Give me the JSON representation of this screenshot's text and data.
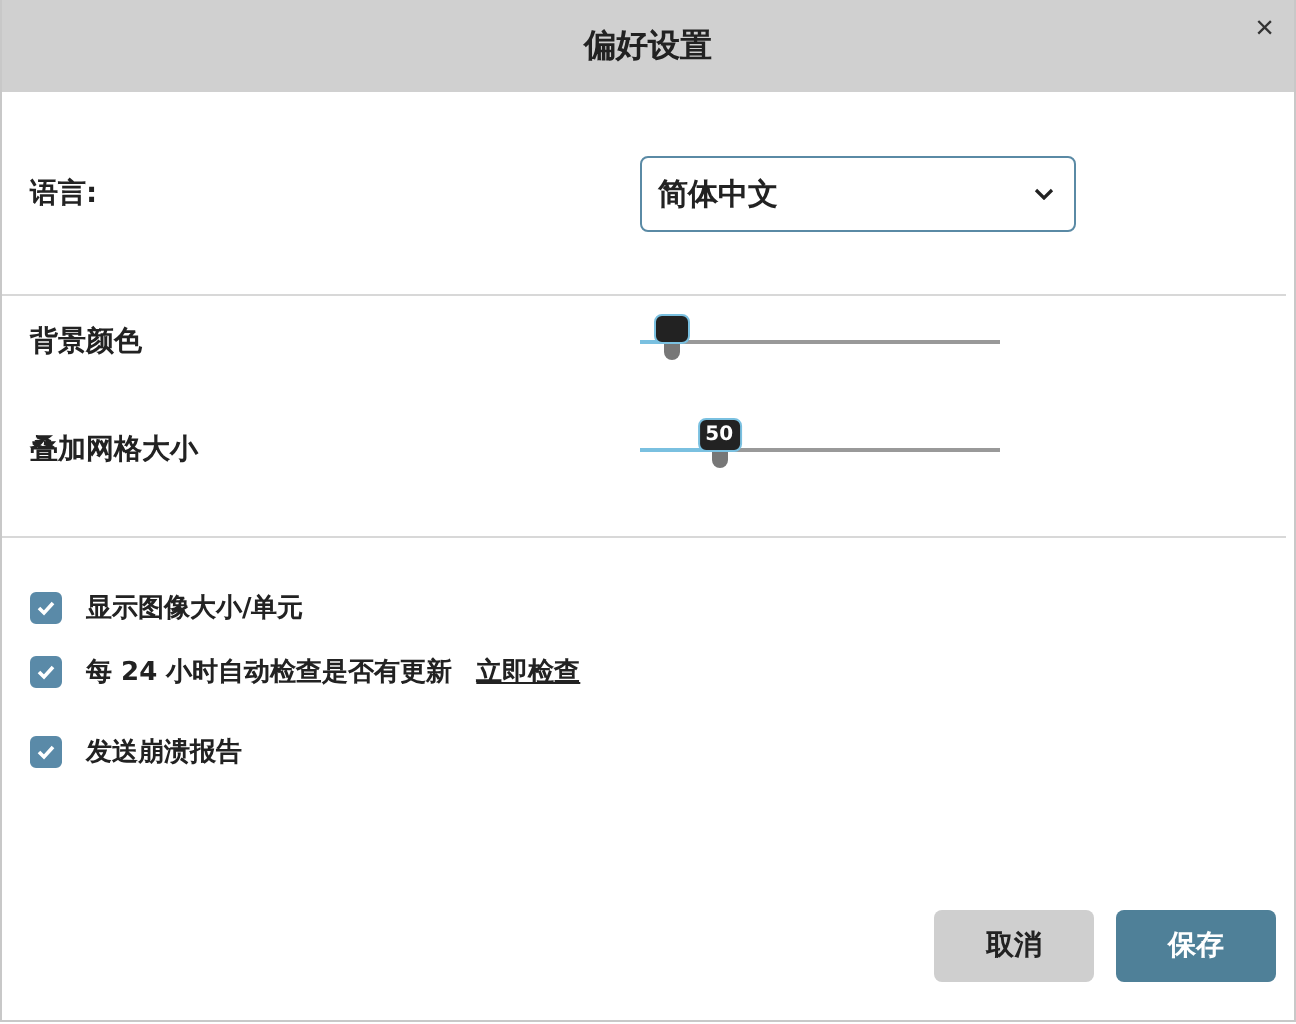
{
  "window": {
    "title": "偏好设置",
    "close": "×"
  },
  "language": {
    "label": "语言:",
    "value": "简体中文"
  },
  "sliders": [
    {
      "label": "背景颜色",
      "kind": "color",
      "level": 0.09
    },
    {
      "label": "叠加网格大小",
      "kind": "number",
      "level": 0.22,
      "reading": "50"
    }
  ],
  "options": [
    {
      "label": "显示图像大小/单元",
      "checked": true
    },
    {
      "label": "每 24 小时自动检查是否有更新",
      "checked": true,
      "link": "立即检查"
    },
    {
      "label": "发送崩溃报告",
      "checked": true
    }
  ],
  "buttons": [
    {
      "label": "取消",
      "kind": "secondary"
    },
    {
      "label": "保存",
      "kind": "primary"
    }
  ]
}
